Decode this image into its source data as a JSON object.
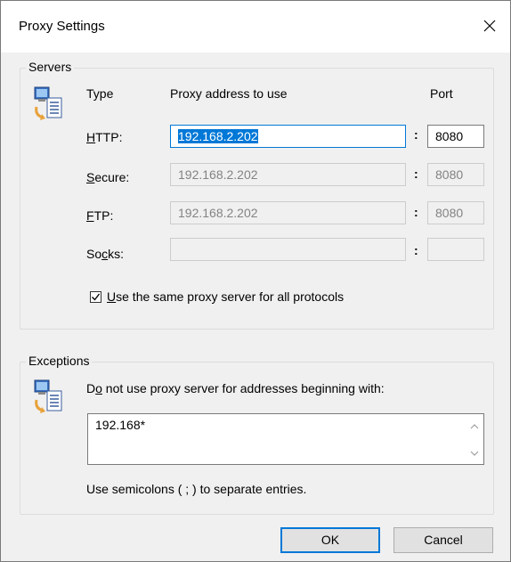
{
  "dialog": {
    "title": "Proxy Settings",
    "close_label": "✕"
  },
  "servers": {
    "legend": "Servers",
    "col_type": "Type",
    "col_address": "Proxy address to use",
    "col_port": "Port",
    "separator": ":",
    "rows": [
      {
        "label_pre": "",
        "label_key": "H",
        "label_post": "TTP:",
        "address": "192.168.2.202",
        "port": "8080",
        "enabled": true
      },
      {
        "label_pre": "",
        "label_key": "S",
        "label_post": "ecure:",
        "address": "192.168.2.202",
        "port": "8080",
        "enabled": false
      },
      {
        "label_pre": "",
        "label_key": "F",
        "label_post": "TP:",
        "address": "192.168.2.202",
        "port": "8080",
        "enabled": false
      },
      {
        "label_pre": "So",
        "label_key": "c",
        "label_post": "ks:",
        "address": "",
        "port": "",
        "enabled": false
      }
    ],
    "same_proxy": {
      "checked": true,
      "label_key": "U",
      "label_post": "se the same proxy server for all protocols"
    }
  },
  "exceptions": {
    "legend": "Exceptions",
    "instruction_pre": "D",
    "instruction_key": "o",
    "instruction_post": " not use proxy server for addresses beginning with:",
    "value": "192.168*",
    "hint": "Use semicolons ( ; ) to separate entries."
  },
  "buttons": {
    "ok": "OK",
    "cancel": "Cancel"
  }
}
